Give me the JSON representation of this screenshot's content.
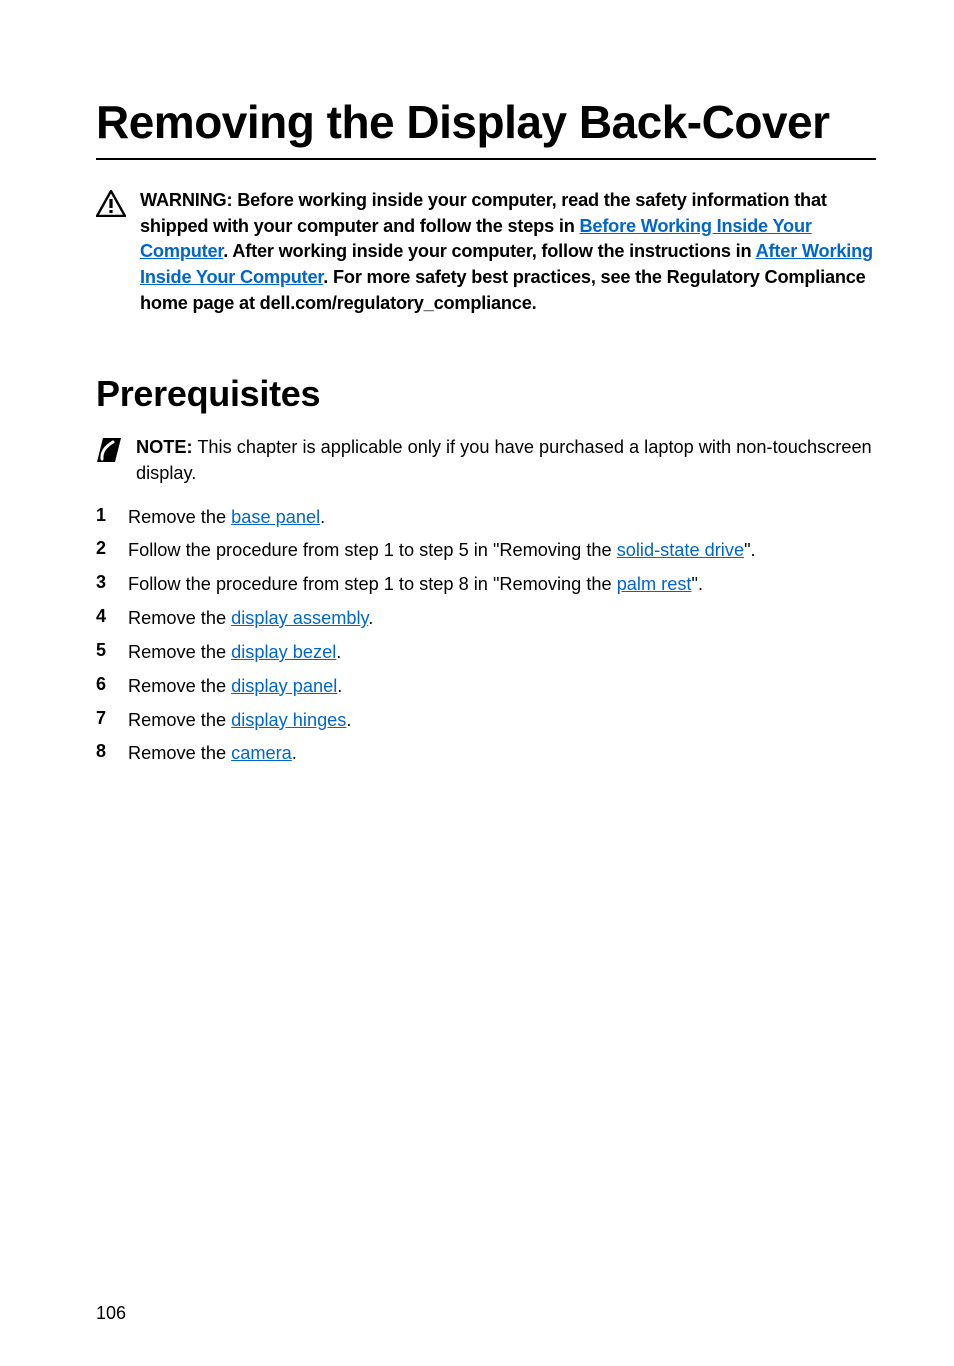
{
  "title": "Removing the Display Back-Cover",
  "warning": {
    "prefix": "WARNING: Before working inside your computer, read the safety information that shipped with your computer and follow the steps in ",
    "link1": "Before Working Inside Your Computer",
    "mid1": ". After working inside your computer, follow the instructions in ",
    "link2": "After Working Inside Your Computer",
    "suffix": ". For more safety best practices, see the Regulatory Compliance home page at dell.com/regulatory_compliance."
  },
  "section_heading": "Prerequisites",
  "note": {
    "label": "NOTE:",
    "text": " This chapter is applicable only if you have purchased a laptop with non-touchscreen display."
  },
  "steps": [
    {
      "pre": "Remove the ",
      "link": "base panel",
      "post": "."
    },
    {
      "pre": "Follow the procedure from step 1 to step 5 in \"Removing the ",
      "link": "solid-state drive",
      "post": "\"."
    },
    {
      "pre": "Follow the procedure from step 1 to step 8 in \"Removing the ",
      "link": "palm rest",
      "post": "\"."
    },
    {
      "pre": "Remove the ",
      "link": "display assembly",
      "post": "."
    },
    {
      "pre": "Remove the ",
      "link": "display bezel",
      "post": "."
    },
    {
      "pre": "Remove the ",
      "link": "display panel",
      "post": "."
    },
    {
      "pre": "Remove the ",
      "link": "display hinges",
      "post": "."
    },
    {
      "pre": "Remove the ",
      "link": "camera",
      "post": "."
    }
  ],
  "page_number": "106"
}
